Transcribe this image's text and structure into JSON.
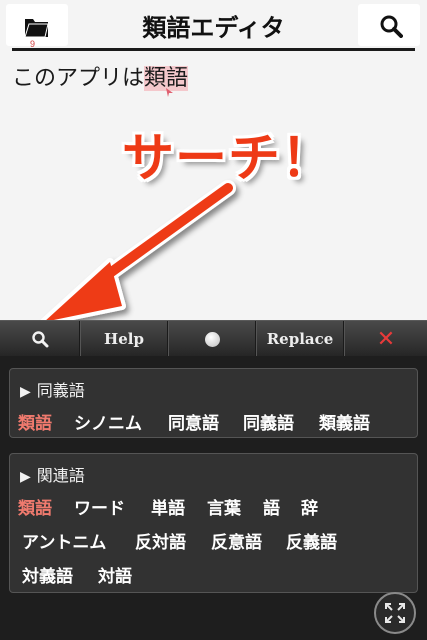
{
  "header": {
    "title": "類語エディタ",
    "folder_count": "9"
  },
  "editor": {
    "text_before": "このアプリは",
    "text_selected": "類語"
  },
  "annotation": {
    "callout": "サーチ！",
    "color": "#ee3a16"
  },
  "toolbar": {
    "help_label": "Help",
    "replace_label": "Replace",
    "close_symbol": "✕"
  },
  "groups": [
    {
      "title": "同義語",
      "words": [
        "類語",
        "シノニム",
        "同意語",
        "同義語",
        "類義語"
      ]
    },
    {
      "title": "関連語",
      "words": [
        "類語",
        "ワード",
        "単語",
        "言葉",
        "語",
        "辞",
        "アントニム",
        "反対語",
        "反意語",
        "反義語",
        "対義語",
        "対語"
      ]
    }
  ],
  "colors": {
    "active_word": "#f07a6e",
    "selection": "#f4c8cc",
    "close": "#e83a3a"
  }
}
